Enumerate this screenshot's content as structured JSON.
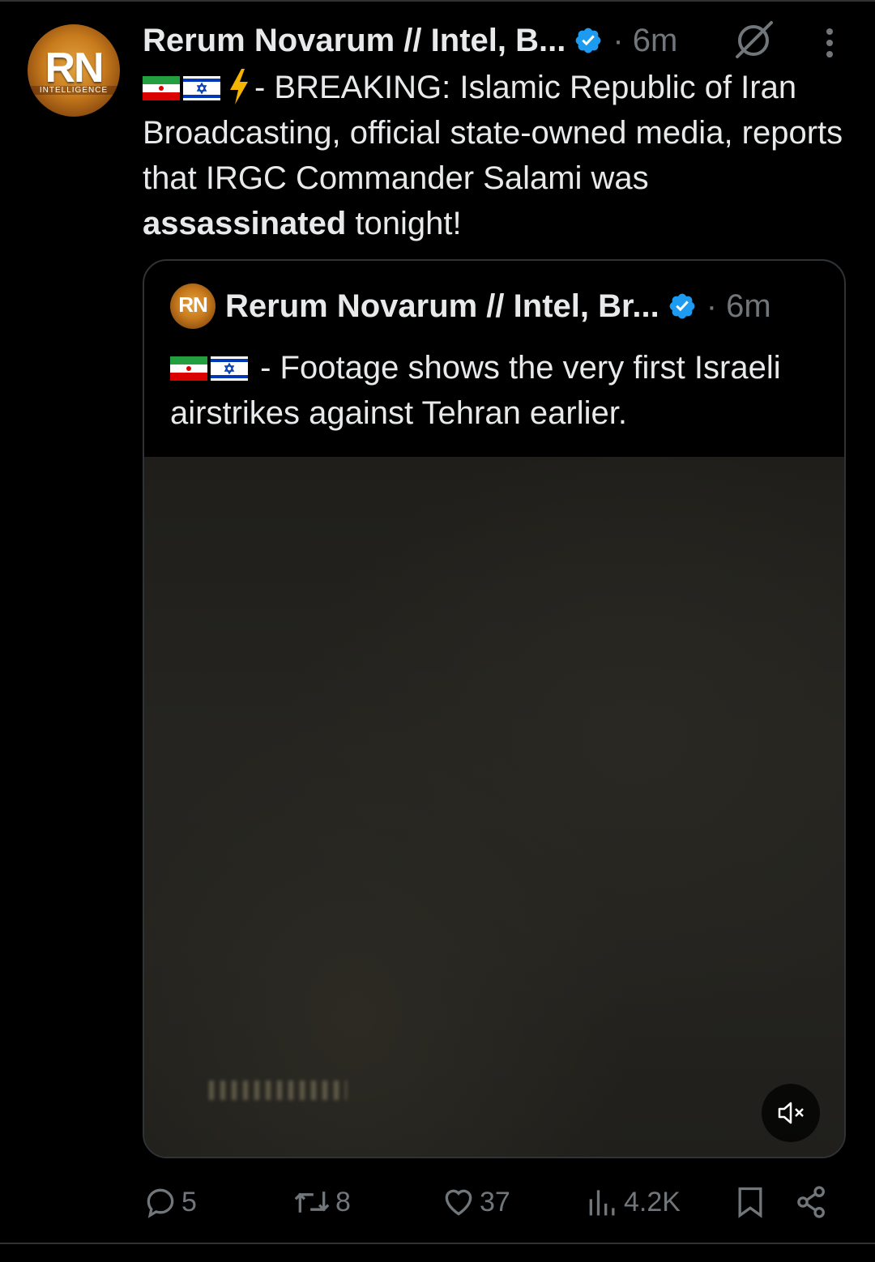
{
  "tweet": {
    "author_name": "Rerum Novarum // Intel, B...",
    "time": "· 6m",
    "avatar": {
      "initials": "RN",
      "tagline": "INTELLIGENCE"
    },
    "text_prefix": "- BREAKING: Islamic Republic of Iran Broadcasting, official state-owned media, reports that IRGC Commander Salami was ",
    "text_bold": "assassinated",
    "text_suffix": " tonight!"
  },
  "quote": {
    "author_name": "Rerum Novarum // Intel, Br...",
    "time": "· 6m",
    "avatar_initials": "RN",
    "text": "- Footage shows the very first Israeli airstrikes against Tehran earlier."
  },
  "actions": {
    "replies": "5",
    "reposts": "8",
    "likes": "37",
    "views": "4.2K"
  },
  "icons": [
    "verified-badge-icon",
    "grok-icon",
    "more-icon",
    "iran-flag-icon",
    "israel-flag-icon",
    "lightning-icon",
    "mute-icon",
    "reply-icon",
    "repost-icon",
    "like-icon",
    "views-icon",
    "bookmark-icon",
    "share-icon"
  ],
  "colors": {
    "background": "#000000",
    "text": "#e7e9ea",
    "muted": "#71767b",
    "verified": "#1d9bf0"
  }
}
